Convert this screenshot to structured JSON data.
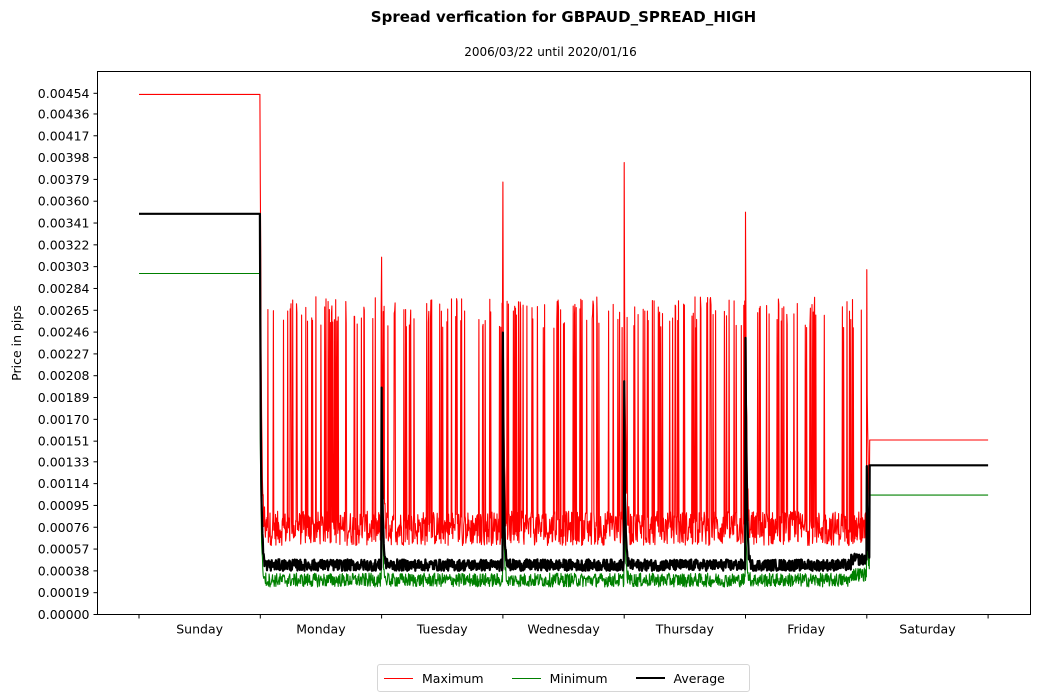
{
  "chart_data": {
    "type": "line",
    "title": "Spread verfication for GBPAUD_SPREAD_HIGH",
    "subtitle": "2006/03/22 until 2020/01/16",
    "xlabel": "",
    "ylabel": "Price in pips",
    "ylim": [
      0.0,
      0.00473
    ],
    "yticks": [
      "0.00000",
      "0.00019",
      "0.00038",
      "0.00057",
      "0.00076",
      "0.00095",
      "0.00114",
      "0.00133",
      "0.00151",
      "0.00170",
      "0.00189",
      "0.00208",
      "0.00227",
      "0.00246",
      "0.00265",
      "0.00284",
      "0.00303",
      "0.00322",
      "0.00341",
      "0.00360",
      "0.00379",
      "0.00398",
      "0.00417",
      "0.00436",
      "0.00454"
    ],
    "categories": [
      "Sunday",
      "Monday",
      "Tuesday",
      "Wednesday",
      "Thursday",
      "Friday",
      "Saturday"
    ],
    "grid": false,
    "legend_position": "bottom-center",
    "series": [
      {
        "name": "Maximum",
        "color": "#ff0000",
        "segments": {
          "Sunday": {
            "flat": 0.00453
          },
          "weekday_baseline": [
            0.0006,
            0.0009
          ],
          "weekday_spike_top": 0.00277,
          "day_open_spikes": {
            "Monday": 0.00437,
            "Tuesday": 0.00316,
            "Wednesday": 0.00407,
            "Thursday": 0.00421,
            "Friday": 0.00395,
            "Saturday": 0.00302
          },
          "Saturday": {
            "flat": 0.00152
          }
        }
      },
      {
        "name": "Minimum",
        "color": "#008000",
        "segments": {
          "Sunday": {
            "flat": 0.00297
          },
          "weekday_baseline": [
            0.00024,
            0.00036
          ],
          "day_open_spikes": {
            "Monday": 0.00176,
            "Tuesday": 0.00133,
            "Wednesday": 0.0014,
            "Thursday": 0.0012,
            "Friday": 0.0011,
            "Saturday": 0.00118
          },
          "Saturday": {
            "flat": 0.00104
          }
        }
      },
      {
        "name": "Average",
        "color": "#000000",
        "segments": {
          "Sunday": {
            "flat": 0.00349
          },
          "weekday_baseline": [
            0.00038,
            0.00048
          ],
          "day_open_spikes": {
            "Monday": 0.00285,
            "Tuesday": 0.0021,
            "Wednesday": 0.0025,
            "Thursday": 0.00205,
            "Friday": 0.003,
            "Saturday": 0.0013
          },
          "Saturday": {
            "flat": 0.0013
          }
        }
      }
    ]
  }
}
